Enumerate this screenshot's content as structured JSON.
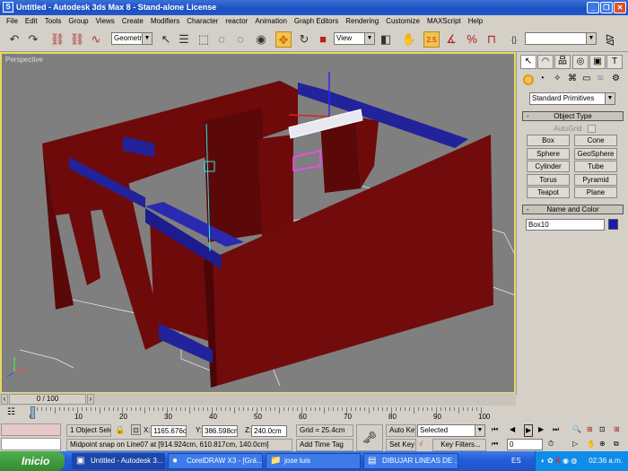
{
  "window": {
    "title": "Untitled - Autodesk 3ds Max 8  - Stand-alone License",
    "buttons": [
      "minimize",
      "restore",
      "close"
    ]
  },
  "menu": [
    "File",
    "Edit",
    "Tools",
    "Group",
    "Views",
    "Create",
    "Modifiers",
    "Character",
    "reactor",
    "Animation",
    "Graph Editors",
    "Rendering",
    "Customize",
    "MAXScript",
    "Help"
  ],
  "toolbar": {
    "selection_filter": "Geometry",
    "ref_coord": "View",
    "named_selection": "",
    "snap_value": "2.5"
  },
  "viewport": {
    "label": "Perspective",
    "wall_color": "#6e0a0a",
    "beam_color": "#22229a",
    "bg_color": "#7f7f7f"
  },
  "command_panel": {
    "category": "Standard Primitives",
    "object_type": {
      "title": "Object Type",
      "autogrid": "AutoGrid",
      "buttons": [
        "Box",
        "Cone",
        "Sphere",
        "GeoSphere",
        "Cylinder",
        "Tube",
        "Torus",
        "Pyramid",
        "Teapot",
        "Plane"
      ]
    },
    "name_color": {
      "title": "Name and Color",
      "name": "Box10",
      "color": "#1a1aa8"
    }
  },
  "time": {
    "slider": "0 / 100",
    "ticks": [
      "0",
      "10",
      "20",
      "30",
      "40",
      "50",
      "60",
      "70",
      "80",
      "90",
      "100"
    ]
  },
  "status": {
    "selection": "1 Object Sele",
    "x": "1165.676c",
    "y": "386.598cm",
    "z": "240.0cm",
    "grid": "Grid = 25.4cm",
    "prompt": "Midpoint snap on Line07 at [914.924cm, 610.817cm, 140.0cm]",
    "add_time_tag": "Add Time Tag",
    "auto_key": "Auto Key",
    "set_key": "Set Key",
    "key_mode": "Selected",
    "key_filters": "Key Filters...",
    "frame": "0"
  },
  "taskbar": {
    "start": "Inicio",
    "tasks": [
      "Untitled - Autodesk 3...",
      "CorelDRAW X3 - [Grá...",
      "jose luis",
      "DIBUJAR LINEAS DE ..."
    ],
    "lang": "ES",
    "clock": "02:36 a.m."
  }
}
